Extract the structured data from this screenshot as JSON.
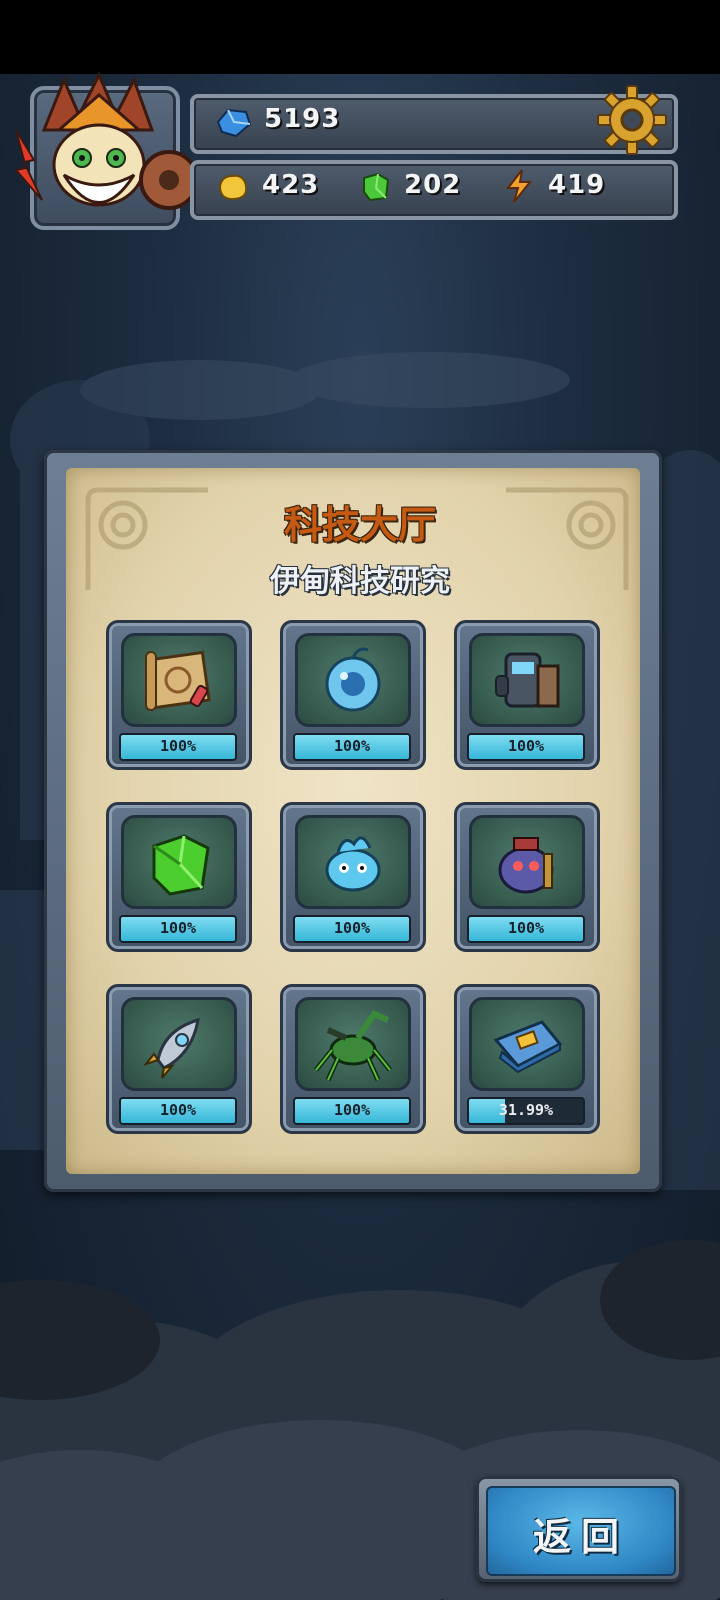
{
  "hud": {
    "gems": "5193",
    "gold": "423",
    "crystal": "202",
    "energy": "419",
    "icons": {
      "gems": "blue-gem-icon",
      "gold": "gold-nugget-icon",
      "crystal": "green-crystal-icon",
      "energy": "lightning-icon",
      "settings": "gear-icon",
      "avatar": "player-avatar"
    }
  },
  "panel": {
    "title": "科技大厅",
    "subtitle": "伊甸科技研究",
    "items": [
      {
        "icon": "map-scroll-icon",
        "progress_label": "100%",
        "progress": 1.0
      },
      {
        "icon": "blue-orb-icon",
        "progress_label": "100%",
        "progress": 1.0
      },
      {
        "icon": "robot-armor-icon",
        "progress_label": "100%",
        "progress": 1.0
      },
      {
        "icon": "green-crystal-icon",
        "progress_label": "100%",
        "progress": 1.0
      },
      {
        "icon": "blue-creature-icon",
        "progress_label": "100%",
        "progress": 1.0
      },
      {
        "icon": "purple-monster-icon",
        "progress_label": "100%",
        "progress": 1.0
      },
      {
        "icon": "rocket-icon",
        "progress_label": "100%",
        "progress": 1.0
      },
      {
        "icon": "mech-spider-icon",
        "progress_label": "100%",
        "progress": 1.0
      },
      {
        "icon": "circuit-chip-icon",
        "progress_label": "31.99%",
        "progress": 0.3199
      }
    ]
  },
  "back_button": {
    "label": "返回"
  },
  "colors": {
    "progress_fill": "#36b7d8",
    "title": "#c65a12",
    "button": "#2f86c4"
  }
}
